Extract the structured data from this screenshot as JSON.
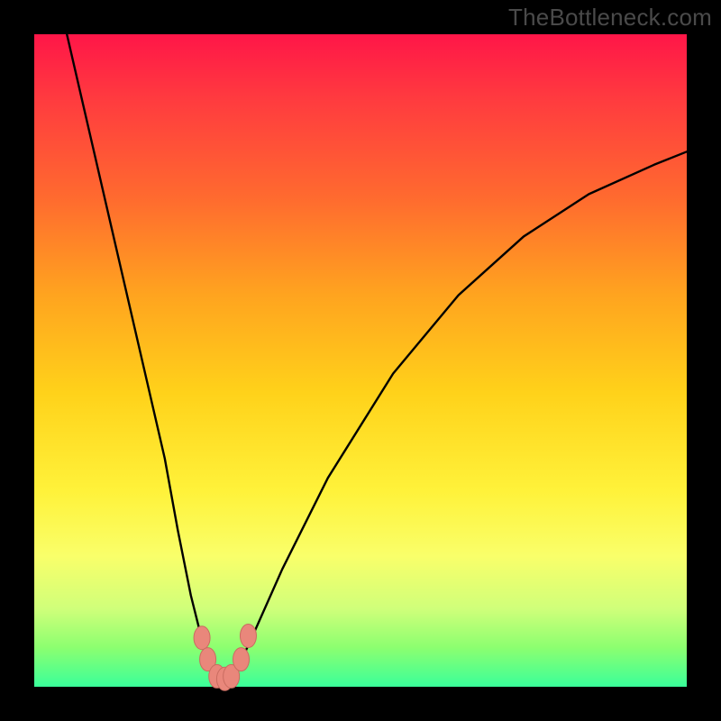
{
  "watermark": "TheBottleneck.com",
  "chart_data": {
    "type": "line",
    "title": "",
    "xlabel": "",
    "ylabel": "",
    "xlim": [
      0,
      100
    ],
    "ylim": [
      0,
      100
    ],
    "annotations": [],
    "series": [
      {
        "name": "bottleneck-curve",
        "x": [
          5,
          8,
          11,
          14,
          17,
          20,
          22,
          24,
          25.5,
          27,
          28,
          29,
          30,
          31.5,
          34,
          38,
          45,
          55,
          65,
          75,
          85,
          95,
          100
        ],
        "y": [
          100,
          87,
          74,
          61,
          48,
          35,
          24,
          14,
          8,
          3.5,
          1.5,
          1,
          1.5,
          3.5,
          9,
          18,
          32,
          48,
          60,
          69,
          75.5,
          80,
          82
        ]
      }
    ],
    "markers": [
      {
        "name": "left-shoulder-top",
        "x": 25.7,
        "y": 7.5
      },
      {
        "name": "left-shoulder-bottom",
        "x": 26.6,
        "y": 4.2
      },
      {
        "name": "valley-left",
        "x": 28.0,
        "y": 1.6
      },
      {
        "name": "valley-center",
        "x": 29.2,
        "y": 1.2
      },
      {
        "name": "valley-right",
        "x": 30.2,
        "y": 1.6
      },
      {
        "name": "right-shoulder-bottom",
        "x": 31.7,
        "y": 4.2
      },
      {
        "name": "right-shoulder-top",
        "x": 32.8,
        "y": 7.8
      }
    ],
    "colors": {
      "curve": "#000000",
      "marker_fill": "#e9877b",
      "marker_stroke": "#c96c60"
    }
  }
}
